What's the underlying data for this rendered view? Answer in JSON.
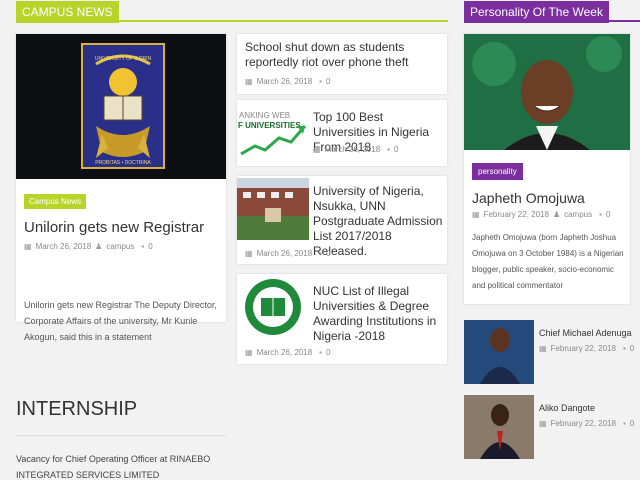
{
  "sections": {
    "campus_news": "CAMPUS NEWS",
    "personality": "Personality Of The Week",
    "internship": "INTERNSHIP"
  },
  "main_article": {
    "category": "Campus News",
    "title": "Unilorin gets new Registrar",
    "date": "March 26, 2018",
    "author": "campus",
    "comments": "0",
    "excerpt": "Unilorin gets new Registrar The Deputy Director, Corporate Affairs of the university, Mr Kunle Akogun, said this  in a statement",
    "logo_text": "UNIVERSITY OF ILORIN",
    "logo_motto": "PROBITAS • DOCTRINA"
  },
  "list_articles": [
    {
      "title": "School shut down as students reportedly riot over phone theft",
      "date": "March 26, 2018",
      "comments": "0"
    },
    {
      "title": "Top 100 Best Universities in Nigeria From 2018",
      "date": "March 26, 2018",
      "comments": "0",
      "thumb_text_1": "ANKING WEB",
      "thumb_text_2": "F UNIVERSITIES"
    },
    {
      "title": "University of Nigeria, Nsukka, UNN Postgraduate Admission List 2017/2018 Released.",
      "date": "March 26, 2018",
      "comments": "0"
    },
    {
      "title": "NUC List of Illegal Universities & Degree Awarding Institutions in Nigeria -2018",
      "date": "March 26, 2018",
      "comments": "0"
    }
  ],
  "personality": {
    "category": "personality",
    "name": "Japheth Omojuwa",
    "date": "February 22, 2018",
    "author": "campus",
    "comments": "0",
    "bio": "Japheth Omojuwa (born Japheth Joshua Omojuwa on 3 October 1984) is a Nigerian blogger, public speaker, socio-economic and political commentator"
  },
  "side_items": [
    {
      "name": "Chief Michael Adenuga",
      "date": "February 22, 2018",
      "comments": "0"
    },
    {
      "name": "Aliko Dangote",
      "date": "February 22, 2018",
      "comments": "0"
    }
  ],
  "internship": {
    "item": "Vacancy for Chief Operating Officer at RINAEBO INTEGRATED SERVICES LIMITED"
  },
  "colors": {
    "campus_accent": "#b8d32a",
    "personality_accent": "#7b2f9e"
  }
}
